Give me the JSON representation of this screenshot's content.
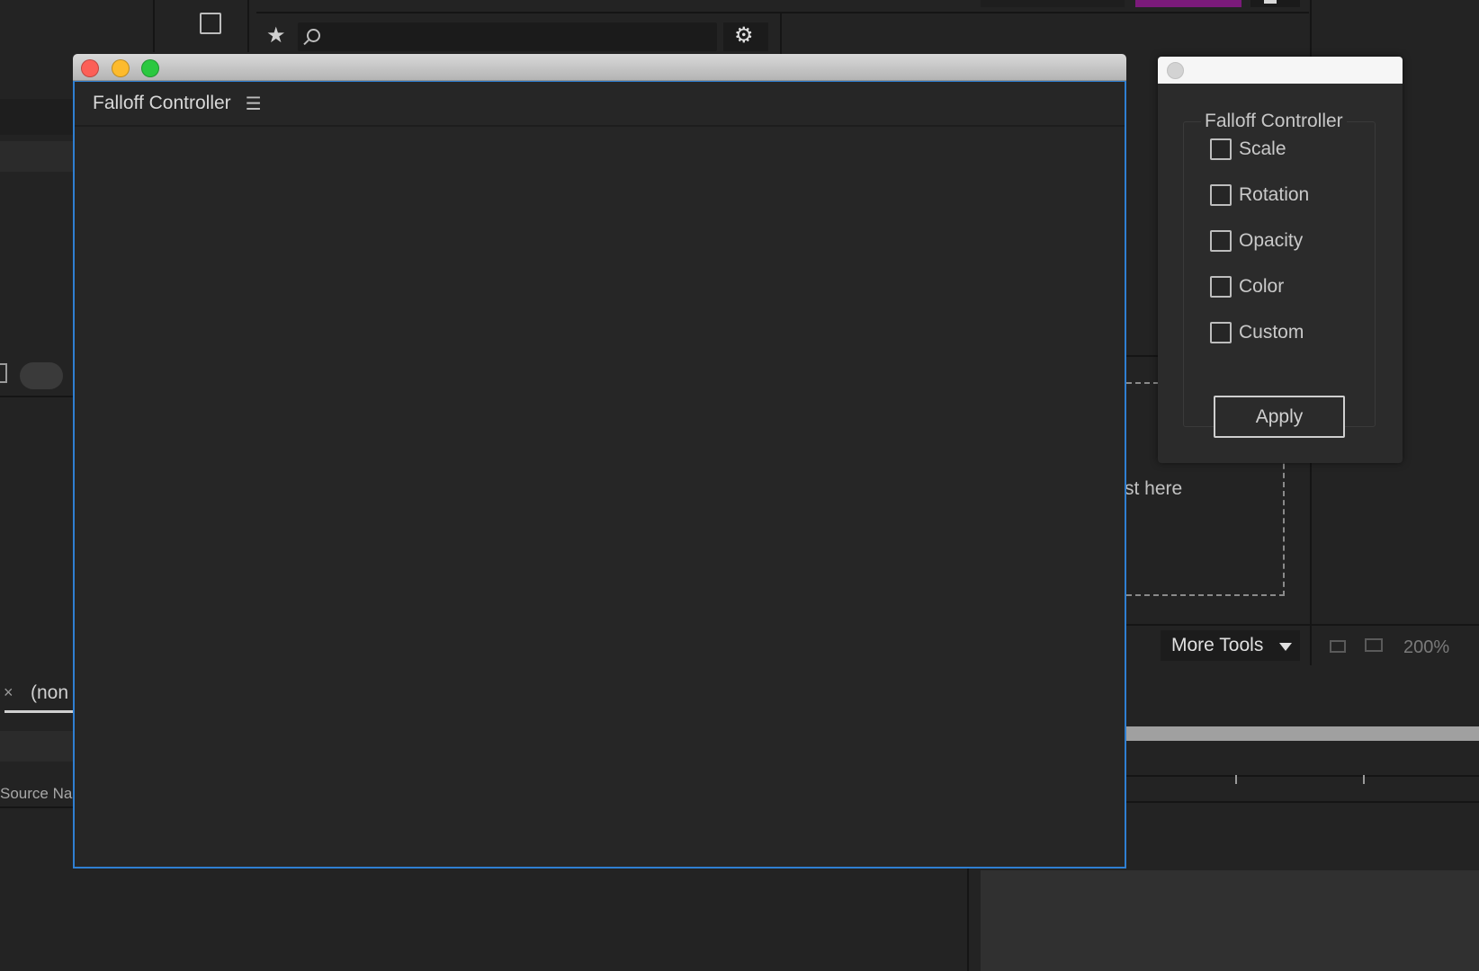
{
  "window": {
    "panel_title": "Falloff Controller",
    "menu_icon": "hamburger-menu-icon"
  },
  "palette": {
    "group_label": "Falloff Controller",
    "options": [
      {
        "label": "Scale",
        "checked": false
      },
      {
        "label": "Rotation",
        "checked": false
      },
      {
        "label": "Opacity",
        "checked": false
      },
      {
        "label": "Color",
        "checked": false
      },
      {
        "label": "Custom",
        "checked": false
      }
    ],
    "apply_label": "Apply"
  },
  "background": {
    "drop_hint": "st here",
    "more_tools_label": "More Tools",
    "zoom_level": "200%",
    "comp_tab_label": "(non",
    "tab_close": "×",
    "source_name_header": "Source Na"
  },
  "colors": {
    "accent_border": "#2f7fd2",
    "close": "#fc5f57",
    "minimize": "#fdbb2e",
    "zoom": "#2bc840",
    "purple_accent": "#7b1a7a"
  }
}
